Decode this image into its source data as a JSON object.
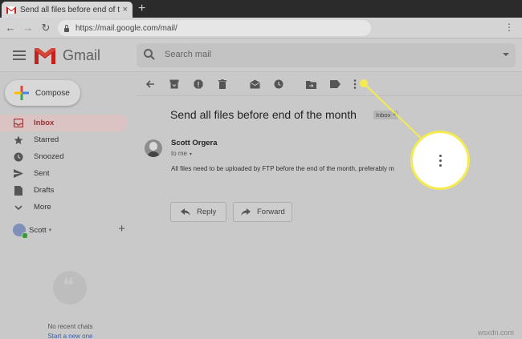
{
  "browser": {
    "tab_title": "Send all files before end of the mo",
    "tab_close": "×",
    "new_tab": "+",
    "url": "https://mail.google.com/mail/"
  },
  "header": {
    "app_name": "Gmail",
    "search_placeholder": "Search mail"
  },
  "sidebar": {
    "compose_label": "Compose",
    "items": [
      {
        "label": "Inbox",
        "icon": "inbox-icon",
        "active": true
      },
      {
        "label": "Starred",
        "icon": "star-icon"
      },
      {
        "label": "Snoozed",
        "icon": "clock-icon"
      },
      {
        "label": "Sent",
        "icon": "send-icon"
      },
      {
        "label": "Drafts",
        "icon": "draft-icon"
      },
      {
        "label": "More",
        "icon": "chevron-down-icon"
      }
    ],
    "user_name": "Scott",
    "user_caret": "▾",
    "add_label": "+",
    "no_chats": "No recent chats",
    "start_new": "Start a new one"
  },
  "message": {
    "subject": "Send all files before end of the month",
    "label_chip": "Inbox",
    "label_chip_close": "×",
    "sender": "Scott Orgera",
    "to": "to me",
    "to_caret": "▾",
    "body": "All files need to be uploaded by FTP before the end of the month, preferably m",
    "reply_label": "Reply",
    "forward_label": "Forward"
  },
  "watermark": "wsxdn.com",
  "colors": {
    "highlight": "#f4ec4e",
    "gmail_red": "#c5221f",
    "inbox_active": "#a03030"
  }
}
